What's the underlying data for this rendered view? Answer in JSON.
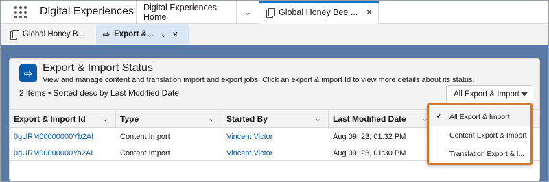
{
  "app": {
    "name": "Digital Experiences",
    "tabs": [
      {
        "label": "Digital Experiences Home"
      },
      {
        "label": "Global Honey Bee ..."
      }
    ]
  },
  "subtabs": [
    {
      "label": "Global Honey B..."
    },
    {
      "label": "Export &..."
    }
  ],
  "page": {
    "title": "Export & Import Status",
    "subtitle": "View and manage content and translation import and export jobs. Click an export & import Id to view more details about its status.",
    "item_count": "2 items • Sorted desc by Last Modified Date",
    "filter_value": "All Export & Import"
  },
  "table": {
    "columns": [
      "Export & Import Id",
      "Type",
      "Started By",
      "Last Modified Date"
    ],
    "rows": [
      {
        "id": "0gURM00000000Yb2AI",
        "type": "Content Import",
        "started_by": "Vincent Victor",
        "modified": "Aug 09, 23, 01:32 PM"
      },
      {
        "id": "0gURM00000000Ya2AI",
        "type": "Content Import",
        "started_by": "Vincent Victor",
        "modified": "Aug 09, 23, 01:30 PM"
      }
    ]
  },
  "dropdown": {
    "options": [
      "All Export & Import",
      "Content Export & Import",
      "Translation Export & I..."
    ],
    "selected": "All Export & Import"
  },
  "colors": {
    "brand_blue": "#0176d3",
    "link": "#0b5cab",
    "highlight_border": "#d2772b",
    "stage_background": "#5a7aa6"
  },
  "icons": {
    "app_launcher": "waffle-icon",
    "tab_record": "document-icon",
    "subtab": "arrow-right-icon",
    "check": "checkmark-icon"
  }
}
